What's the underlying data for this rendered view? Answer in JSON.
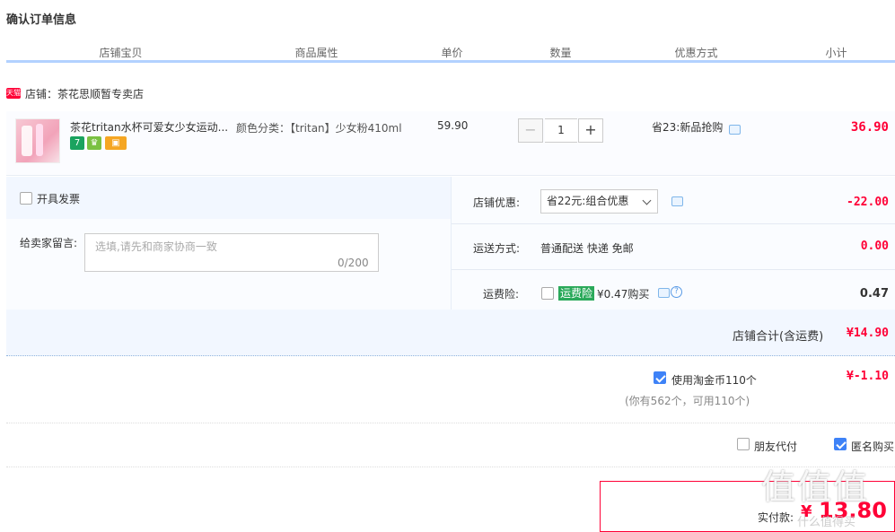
{
  "page": {
    "title": "确认订单信息"
  },
  "columns": [
    "店铺宝贝",
    "商品属性",
    "单价",
    "数量",
    "优惠方式",
    "小计"
  ],
  "shop": {
    "badge": "天猫",
    "label": "店铺：茶花思顺暂专卖店"
  },
  "item": {
    "title": "茶花tritan水杯可爱女少女运动...",
    "attr_label": "颜色分类：",
    "attr_value": "【tritan】少女粉410ml",
    "price": "59.90",
    "qty": "1",
    "minus_label": "−",
    "plus_label": "+",
    "promo": "省23:新品抢购",
    "subtotal": "36.90",
    "badges": [
      "7",
      "♛",
      "▣"
    ]
  },
  "invoice": {
    "label": "开具发票"
  },
  "memo": {
    "label": "给卖家留言:",
    "placeholder": "选填,请先和商家协商一致",
    "count": "0/200"
  },
  "shop_discount": {
    "label": "店铺优惠:",
    "selected": "省22元:组合优惠",
    "amount": "-22.00"
  },
  "shipping": {
    "label": "运送方式:",
    "value": "普通配送 快递 免邮",
    "amount": "0.00"
  },
  "insurance": {
    "label": "运费险:",
    "tag": "运费险",
    "value": "¥0.47购买",
    "amount": "0.47"
  },
  "shop_total": {
    "label": "店铺合计(含运费)",
    "amount": "¥14.90"
  },
  "coins": {
    "label": "使用淘金币110个",
    "note": "(你有562个，可用110个)",
    "amount": "¥-1.10"
  },
  "options": {
    "friend_pay": "朋友代付",
    "anonymous": "匿名购买"
  },
  "pay": {
    "label": "实付款:",
    "currency": "¥",
    "amount": "13.80"
  },
  "watermark": {
    "text": "值值值",
    "site": "什么值得买"
  },
  "colors": {
    "accent": "#ff0036",
    "header_line": "#b2d1ff",
    "checkbox": "#3e82f7",
    "insurance_tag": "#2aa95a"
  }
}
